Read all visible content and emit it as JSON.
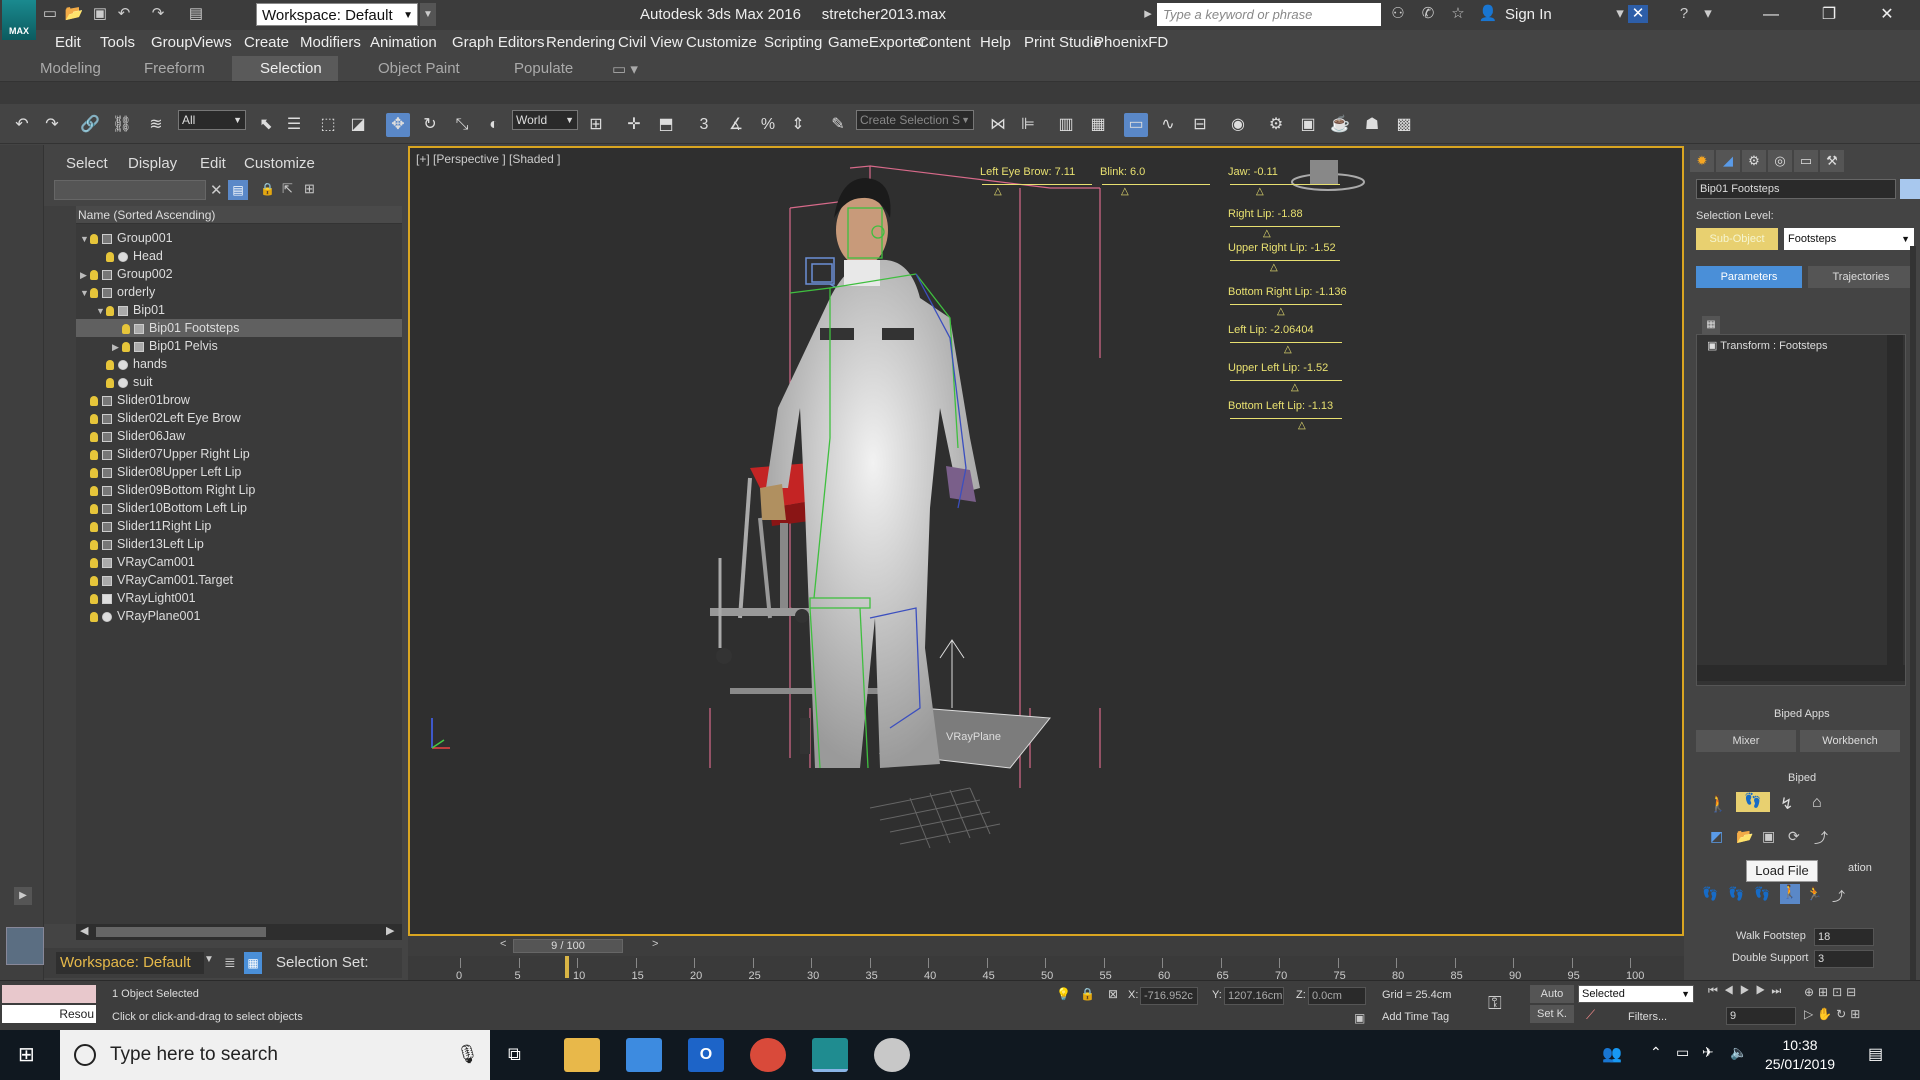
{
  "window": {
    "app_title": "Autodesk 3ds Max 2016     stretcher2013.max",
    "workspace": "Workspace: Default",
    "search_placeholder": "Type a keyword or phrase",
    "sign_in": "Sign In",
    "app_icon_label": "MAX"
  },
  "menu": [
    "Edit",
    "Tools",
    "Group",
    "Views",
    "Create",
    "Modifiers",
    "Animation",
    "Graph Editors",
    "Rendering",
    "Civil View",
    "Customize",
    "Scripting",
    "GameExporter",
    "Content",
    "Help",
    "Print Studio",
    "PhoenixFD"
  ],
  "ribbon_tabs": [
    "Modeling",
    "Freeform",
    "Selection",
    "Object Paint",
    "Populate"
  ],
  "ribbon_active_tab": "Selection",
  "toolbar": {
    "filter": "All",
    "coord_system": "World",
    "selection_set": "Create Selection S"
  },
  "explorer": {
    "tabs": [
      "Select",
      "Display",
      "Edit",
      "Customize"
    ],
    "header": "Name (Sorted Ascending)",
    "rows": [
      {
        "name": "Group001",
        "indent": 0,
        "expand": "▼",
        "icon": "group",
        "selected": false
      },
      {
        "name": "Head",
        "indent": 1,
        "expand": "",
        "icon": "sphere",
        "selected": false
      },
      {
        "name": "Group002",
        "indent": 0,
        "expand": "▶",
        "icon": "group",
        "selected": false
      },
      {
        "name": "orderly",
        "indent": 0,
        "expand": "▼",
        "icon": "group",
        "selected": false
      },
      {
        "name": "Bip01",
        "indent": 1,
        "expand": "▼",
        "icon": "biped",
        "selected": false
      },
      {
        "name": "Bip01 Footsteps",
        "indent": 2,
        "expand": "",
        "icon": "biped",
        "selected": true
      },
      {
        "name": "Bip01 Pelvis",
        "indent": 2,
        "expand": "▶",
        "icon": "biped",
        "selected": false
      },
      {
        "name": "hands",
        "indent": 1,
        "expand": "",
        "icon": "sphere",
        "selected": false
      },
      {
        "name": "suit",
        "indent": 1,
        "expand": "",
        "icon": "sphere",
        "selected": false
      },
      {
        "name": "Slider01brow",
        "indent": 0,
        "expand": "",
        "icon": "group",
        "selected": false
      },
      {
        "name": "Slider02Left Eye Brow",
        "indent": 0,
        "expand": "",
        "icon": "group",
        "selected": false
      },
      {
        "name": "Slider06Jaw",
        "indent": 0,
        "expand": "",
        "icon": "group",
        "selected": false
      },
      {
        "name": "Slider07Upper Right Lip",
        "indent": 0,
        "expand": "",
        "icon": "group",
        "selected": false
      },
      {
        "name": "Slider08Upper Left Lip",
        "indent": 0,
        "expand": "",
        "icon": "group",
        "selected": false
      },
      {
        "name": "Slider09Bottom Right Lip",
        "indent": 0,
        "expand": "",
        "icon": "group",
        "selected": false
      },
      {
        "name": "Slider10Bottom Left Lip",
        "indent": 0,
        "expand": "",
        "icon": "group",
        "selected": false
      },
      {
        "name": "Slider11Right Lip",
        "indent": 0,
        "expand": "",
        "icon": "group",
        "selected": false
      },
      {
        "name": "Slider13Left Lip",
        "indent": 0,
        "expand": "",
        "icon": "group",
        "selected": false
      },
      {
        "name": "VRayCam001",
        "indent": 0,
        "expand": "",
        "icon": "camera",
        "selected": false
      },
      {
        "name": "VRayCam001.Target",
        "indent": 0,
        "expand": "",
        "icon": "camera",
        "selected": false
      },
      {
        "name": "VRayLight001",
        "indent": 0,
        "expand": "",
        "icon": "light",
        "selected": false
      },
      {
        "name": "VRayPlane001",
        "indent": 0,
        "expand": "",
        "icon": "sphere",
        "selected": false
      }
    ]
  },
  "viewport": {
    "label": "[+] [Perspective ] [Shaded ]",
    "plane_label": "VRayPlane",
    "sliders": [
      {
        "label": "Left Eye Brow: 7.11"
      },
      {
        "label": "Blink: 6.0"
      },
      {
        "label": "Jaw: -0.11"
      },
      {
        "label": "Right Lip: -1.88"
      },
      {
        "label": "Upper Right Lip: -1.52"
      },
      {
        "label": "Bottom Right Lip: -1.136"
      },
      {
        "label": "Left Lip: -2.06404"
      },
      {
        "label": "Upper Left Lip: -1.52"
      },
      {
        "label": "Bottom Left Lip: -1.13"
      }
    ]
  },
  "command_panel": {
    "object_name": "Bip01 Footsteps",
    "selection_level_label": "Selection Level:",
    "sub_object": "Sub-Object",
    "level_value": "Footsteps",
    "tabs": [
      "Parameters",
      "Trajectories"
    ],
    "modifier_item": "Transform : Footsteps",
    "biped_apps": "Biped Apps",
    "mixer": "Mixer",
    "workbench": "Workbench",
    "biped": "Biped",
    "creation_tail": "ation",
    "walk_footstep_label": "Walk Footstep",
    "walk_footstep_value": "18",
    "double_support_label": "Double Support",
    "double_support_value": "3",
    "tooltip": "Load File"
  },
  "timeline": {
    "frame": "9 / 100",
    "ticks": [
      "0",
      "5",
      "10",
      "15",
      "20",
      "25",
      "30",
      "35",
      "40",
      "45",
      "50",
      "55",
      "60",
      "65",
      "70",
      "75",
      "80",
      "85",
      "90",
      "95",
      "100"
    ],
    "current": 9
  },
  "bottom": {
    "workspace": "Workspace: Default",
    "selection_set": "Selection Set:",
    "maxscript": "Resou",
    "objects_selected": "1 Object Selected",
    "prompt": "Click or click-and-drag to select objects",
    "x_label": "X:",
    "x_value": "-716.952c",
    "y_label": "Y:",
    "y_value": "1207.16cm",
    "z_label": "Z:",
    "z_value": "0.0cm",
    "grid": "Grid = 25.4cm",
    "add_time_tag": "Add Time Tag",
    "auto": "Auto",
    "set_key": "Set K.",
    "key_mode": "Selected",
    "filters": "Filters...",
    "frame_field": "9"
  },
  "taskbar": {
    "search": "Type here to search",
    "time": "10:38",
    "date": "25/01/2019"
  },
  "colors": {
    "viewport_border": "#d9a521",
    "slider_text": "#e8e070",
    "selection_blue": "#5a88c8"
  }
}
